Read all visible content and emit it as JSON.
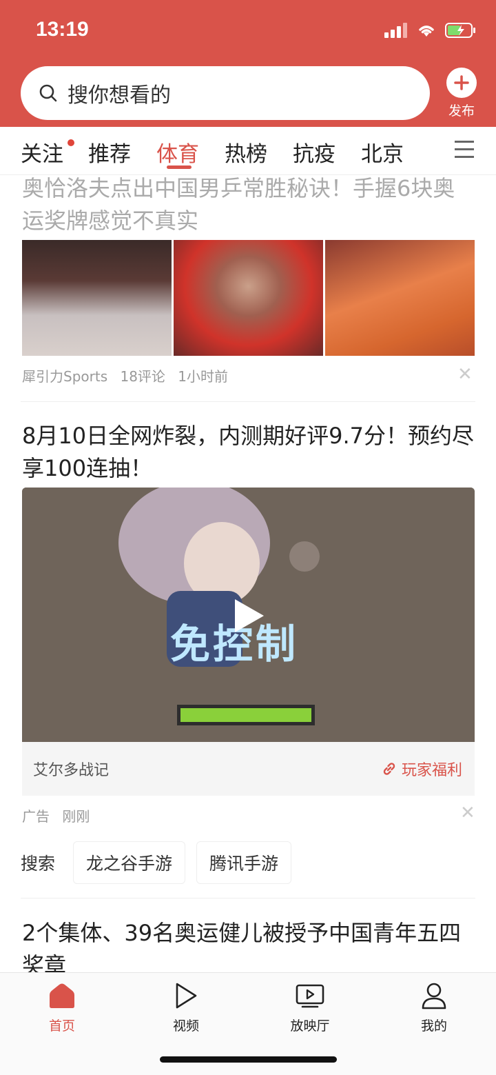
{
  "status": {
    "time": "13:19"
  },
  "header": {
    "search_placeholder": "搜你想看的",
    "publish_label": "发布"
  },
  "tabs": [
    {
      "label": "关注"
    },
    {
      "label": "推荐"
    },
    {
      "label": "体育"
    },
    {
      "label": "热榜"
    },
    {
      "label": "抗疫"
    },
    {
      "label": "北京"
    }
  ],
  "feed": {
    "article1": {
      "title": "奥恰洛夫点出中国男乒常胜秘诀！手握6块奥运奖牌感觉不真实",
      "source": "犀引力Sports",
      "comments": "18评论",
      "time": "1小时前"
    },
    "ad": {
      "title": "8月10日全网炸裂，内测期好评9.7分！预约尽享100连抽！",
      "video_caption": "免控制",
      "advertiser": "艾尔多战记",
      "cta": "玩家福利",
      "tag": "广告",
      "time": "刚刚"
    },
    "search_row": {
      "label": "搜索",
      "chips": [
        "龙之谷手游",
        "腾讯手游"
      ]
    },
    "article2": {
      "title": "2个集体、39名奥运健儿被授予中国青年五四奖章"
    }
  },
  "bottom_nav": [
    {
      "label": "首页"
    },
    {
      "label": "视频"
    },
    {
      "label": "放映厅"
    },
    {
      "label": "我的"
    }
  ],
  "colors": {
    "brand": "#d9534a"
  }
}
